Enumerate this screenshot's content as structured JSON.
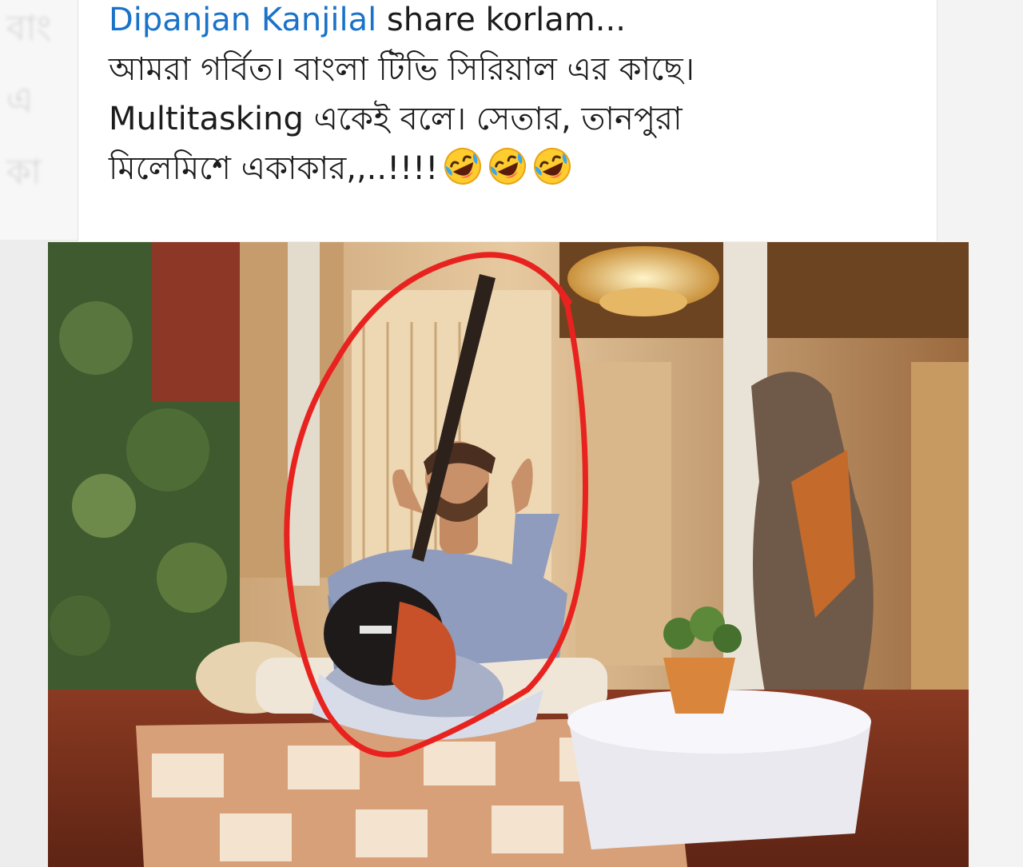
{
  "post": {
    "author": "Dipanjan Kanjilal",
    "author_suffix": " share korlam...",
    "lines": [
      "আমরা গর্বিত। বাংলা টিভি সিরিয়াল এর কাছে।",
      "Multitasking একেই বলে। সেতার, তানপুরা",
      "মিলেমিশে একাকার,,..!!!!"
    ],
    "emoji_count": 3,
    "emoji_name": "rolling-on-the-floor-laughing"
  },
  "colors": {
    "link": "#1a73c9",
    "text": "#1c1c1c",
    "annotation_circle": "#e8231f"
  }
}
